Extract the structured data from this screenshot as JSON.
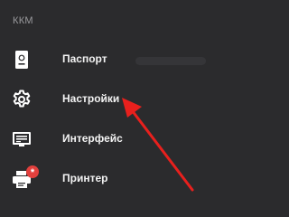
{
  "sidebar": {
    "section_title": "ККМ",
    "items": [
      {
        "label": "Паспорт",
        "icon": "passport-icon"
      },
      {
        "label": "Настройки",
        "icon": "gear-icon"
      },
      {
        "label": "Интерфейс",
        "icon": "interface-icon"
      },
      {
        "label": "Принтер",
        "icon": "printer-icon"
      }
    ],
    "printer_badge": "*"
  },
  "annotation": {
    "arrow_color": "#e8201d",
    "arrow_target": "Настройки"
  },
  "colors": {
    "background": "#2b2b2d",
    "text": "#f2f2f2",
    "muted_text": "#9a9a9d",
    "badge": "#e2403d"
  }
}
